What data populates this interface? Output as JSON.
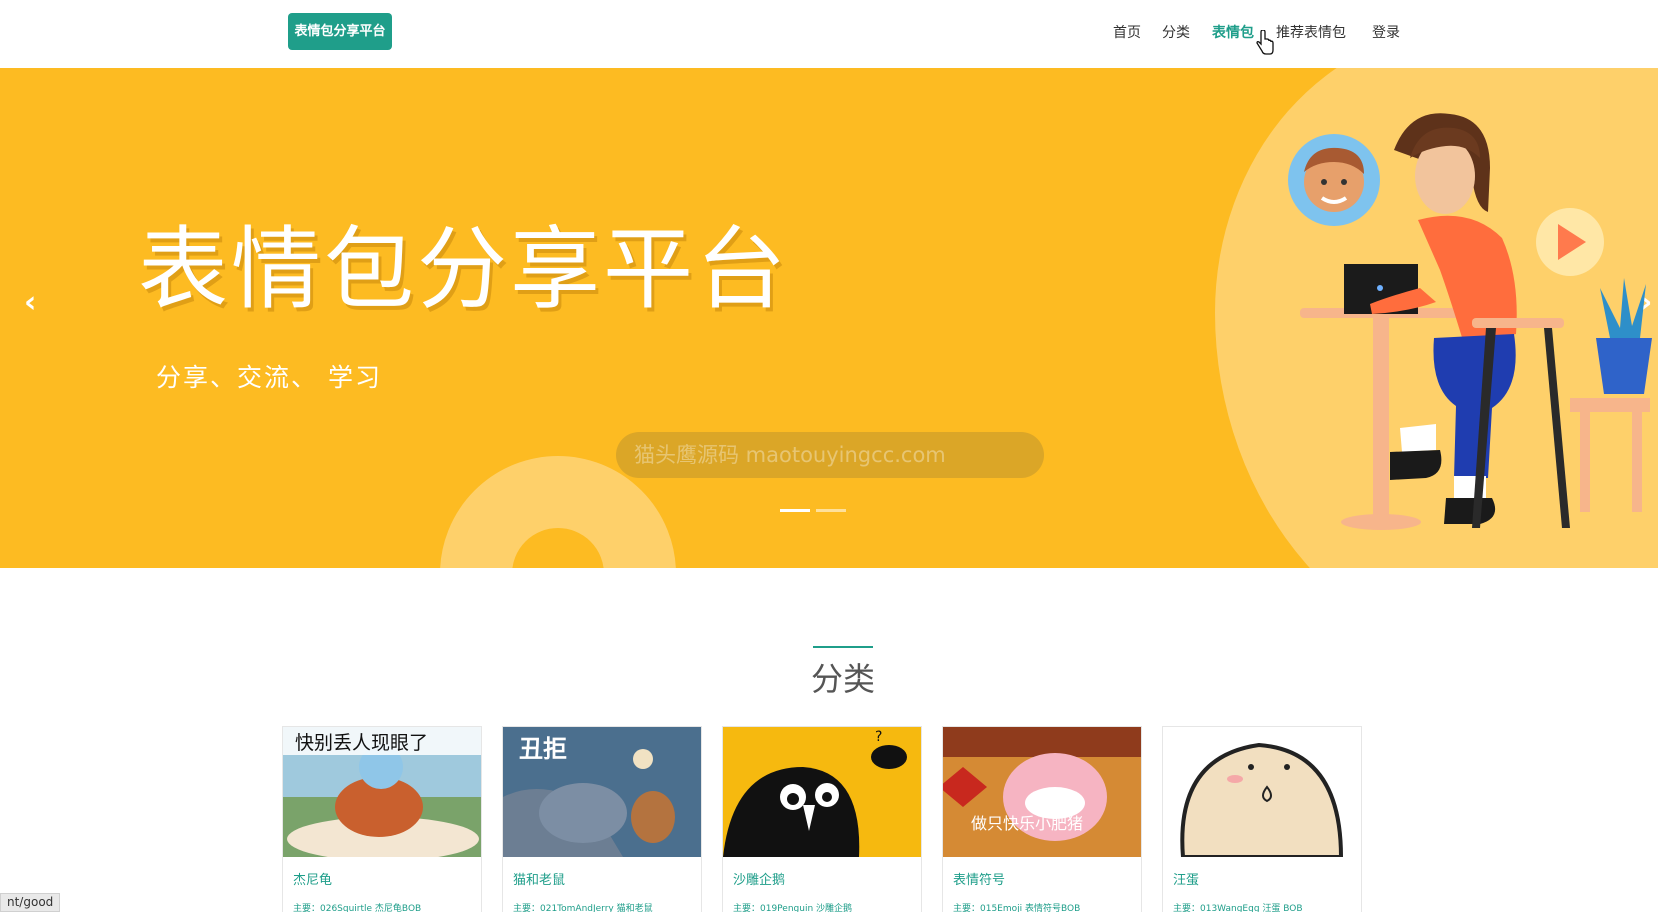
{
  "header": {
    "brand": "表情包分享平台",
    "nav": [
      "首页",
      "分类",
      "表情包",
      "推荐表情包",
      "登录"
    ],
    "active_index": 2
  },
  "banner": {
    "title": "表情包分享平台",
    "subtitle": "分享、交流、 学习",
    "watermark": "猫头鹰源码 maotouyingcc.com",
    "prev_label": "‹",
    "next_label": "›",
    "slides": 2,
    "active_slide": 0
  },
  "section": {
    "title": "分类"
  },
  "cards": [
    {
      "name": "杰尼龟",
      "desc": "主要：026Squirtle 杰尼龟BOB",
      "thumb_text": "快别丢人现眼了"
    },
    {
      "name": "猫和老鼠",
      "desc": "主要：021TomAndJerry 猫和老鼠",
      "thumb_text": "丑拒"
    },
    {
      "name": "沙雕企鹅",
      "desc": "主要：019Penguin 沙雕企鹅",
      "thumb_text": ""
    },
    {
      "name": "表情符号",
      "desc": "主要：015Emoji 表情符号BOB",
      "thumb_text": "做只快乐小肥猪"
    },
    {
      "name": "汪蛋",
      "desc": "主要：013WangEgg 汪蛋 BOB",
      "thumb_text": ""
    }
  ],
  "status_bar": "nt/good",
  "colors": {
    "accent": "#1f9e8a",
    "banner": "#fdbb22"
  }
}
